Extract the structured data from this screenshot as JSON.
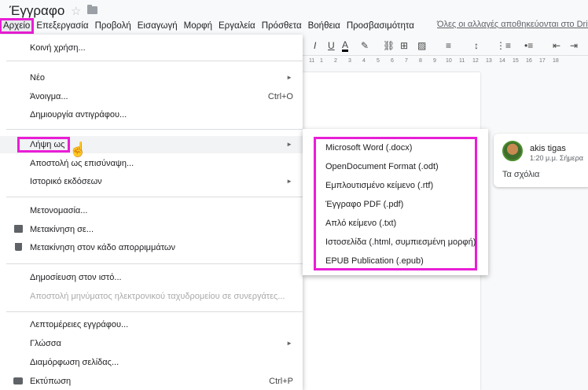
{
  "title": "Έγγραφο",
  "icons": {
    "star": "star-icon",
    "folder": "folder-icon"
  },
  "menubar": [
    "Αρχείο",
    "Επεξεργασία",
    "Προβολή",
    "Εισαγωγή",
    "Μορφή",
    "Εργαλεία",
    "Πρόσθετα",
    "Βοήθεια",
    "Προσβασιμότητα"
  ],
  "saved_status": "Όλες οι αλλαγές αποθηκεύονται στο Drive",
  "ruler_numbers": [
    "11",
    "1",
    "2",
    "3",
    "4",
    "5",
    "6",
    "7",
    "8",
    "9",
    "10",
    "11",
    "12",
    "13",
    "14",
    "15",
    "16",
    "17",
    "18"
  ],
  "file_menu": {
    "share": "Κοινή χρήση...",
    "new": "Νέο",
    "open": "Άνοιγμα...",
    "open_shortcut": "Ctrl+O",
    "make_copy": "Δημιουργία αντιγράφου...",
    "download_as": "Λήψη ως",
    "email_as": "Αποστολή ως επισύναψη...",
    "version_history": "Ιστορικό εκδόσεων",
    "rename": "Μετονομασία...",
    "move": "Μετακίνηση σε...",
    "trash": "Μετακίνηση στον κάδο απορριμμάτων",
    "publish": "Δημοσίευση στον ιστό...",
    "email_collaborators": "Αποστολή μηνύματος ηλεκτρονικού ταχυδρομείου σε συνεργάτες...",
    "details": "Λεπτομέρειες εγγράφου...",
    "language": "Γλώσσα",
    "page_setup": "Διαμόρφωση σελίδας...",
    "print": "Εκτύπωση",
    "print_shortcut": "Ctrl+P"
  },
  "download_submenu": [
    "Microsoft Word (.docx)",
    "OpenDocument Format (.odt)",
    "Εμπλουτισμένο κείμενο (.rtf)",
    "Έγγραφο PDF (.pdf)",
    "Απλό κείμενο (.txt)",
    "Ιστοσελίδα (.html, συμπιεσμένη μορφή)",
    "EPUB Publication (.epub)"
  ],
  "comment": {
    "author": "akis tigas",
    "time": "1:20 μ.μ. Σήμερα",
    "text": "Τα σχόλια"
  },
  "highlight_color": "#e91ed5"
}
